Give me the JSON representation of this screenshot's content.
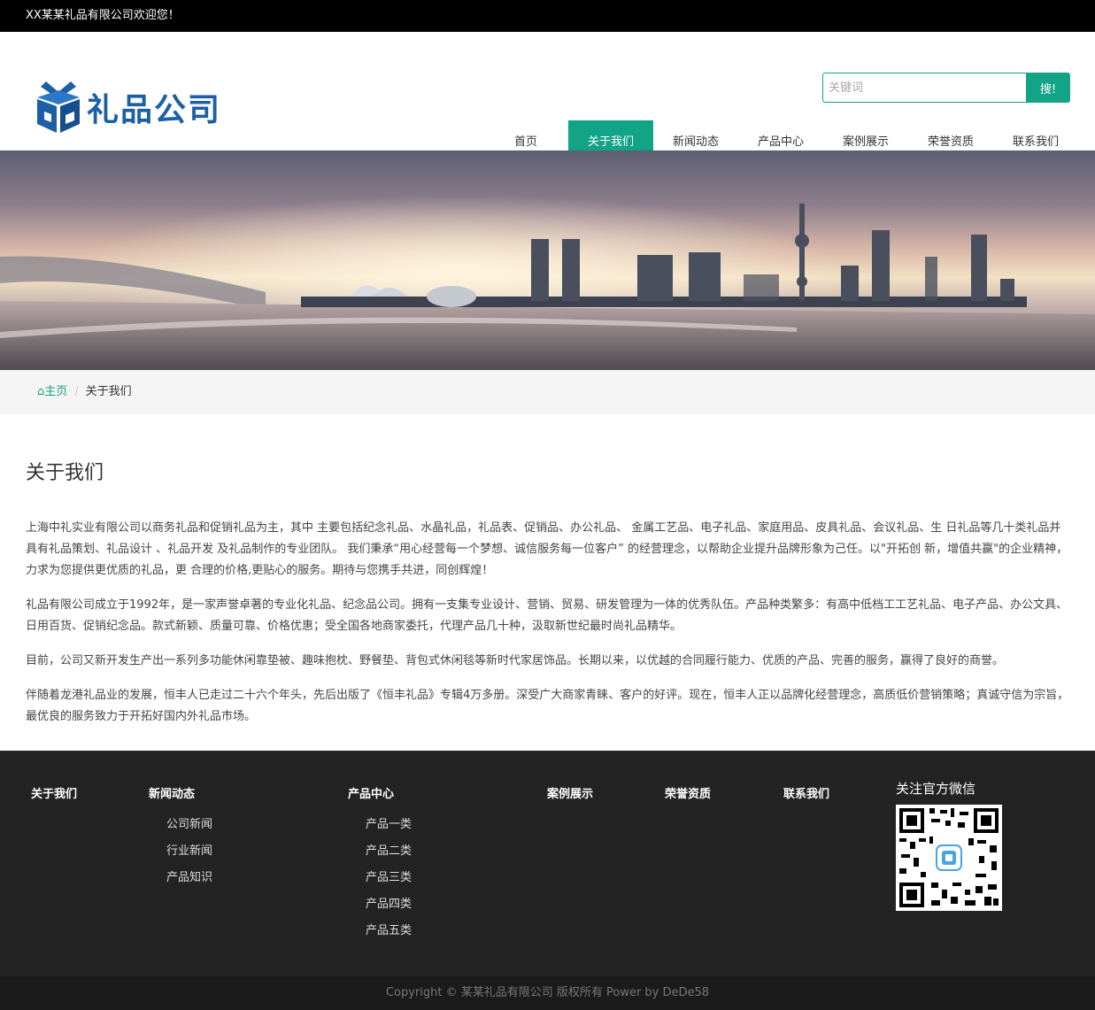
{
  "topbar": {
    "welcome": "XX某某礼品有限公司欢迎您！"
  },
  "header": {
    "logo_text": "礼品公司",
    "search_placeholder": "关键词",
    "search_button": "搜!"
  },
  "nav": [
    {
      "label": "首页",
      "active": false
    },
    {
      "label": "关于我们",
      "active": true
    },
    {
      "label": "新闻动态",
      "active": false
    },
    {
      "label": "产品中心",
      "active": false
    },
    {
      "label": "案例展示",
      "active": false
    },
    {
      "label": "荣誉资质",
      "active": false
    },
    {
      "label": "联系我们",
      "active": false
    }
  ],
  "breadcrumb": {
    "home": "主页",
    "current": "关于我们"
  },
  "content": {
    "title": "关于我们",
    "paragraphs": [
      "上海中礼实业有限公司以商务礼品和促销礼品为主，其中 主要包括纪念礼品、水晶礼品，礼品表、促销品、办公礼品、 金属工艺品、电子礼品、家庭用品、皮具礼品、会议礼品、生 日礼品等几十类礼品并具有礼品策划、礼品设计 、礼品开发 及礼品制作的专业团队。 我们秉承“用心经营每一个梦想、诚信服务每一位客户” 的经营理念，以帮助企业提升品牌形象为己任。以\"开拓创 新，增值共赢\"的企业精神，力求为您提供更优质的礼品，更 合理的价格,更贴心的服务。期待与您携手共进，同创辉煌！",
      "礼品有限公司成立于1992年，是一家声誉卓著的专业化礼品、纪念品公司。拥有一支集专业设计、营销、贸易、研发管理为一体的优秀队伍。产品种类繁多：有高中低档工工艺礼品、电子产品、办公文具、日用百货、促销纪念品。款式新颖、质量可靠、价格优惠；受全国各地商家委托，代理产品几十种，汲取新世纪最时尚礼品精华。",
      "目前，公司又新开发生产出一系列多功能休闲靠垫被、趣味抱枕、野餐垫、背包式休闲毯等新时代家居饰品。长期以来，以优越的合同履行能力、优质的产品、完善的服务，赢得了良好的商誉。",
      "伴随着龙港礼品业的发展，恒丰人已走过二十六个年头，先后出版了《恒丰礼品》专辑4万多册。深受广大商家青睐、客户的好评。现在，恒丰人正以品牌化经营理念，高质低价营销策略；真诚守信为宗旨，最优良的服务致力于开拓好国内外礼品市场。"
    ]
  },
  "footer": {
    "columns": [
      {
        "title": "关于我们",
        "items": []
      },
      {
        "title": "新闻动态",
        "items": [
          "公司新闻",
          "行业新闻",
          "产品知识"
        ]
      },
      {
        "title": "产品中心",
        "items": [
          "产品一类",
          "产品二类",
          "产品三类",
          "产品四类",
          "产品五类"
        ]
      },
      {
        "title": "案例展示",
        "items": []
      },
      {
        "title": "荣誉资质",
        "items": []
      },
      {
        "title": "联系我们",
        "items": []
      }
    ],
    "wechat_title": "关注官方微信",
    "copyright": "Copyright © 某某礼品有限公司 版权所有 Power by DeDe58"
  },
  "colors": {
    "accent": "#13a386",
    "logo": "#1b5fa7",
    "footer_bg": "#232323"
  }
}
